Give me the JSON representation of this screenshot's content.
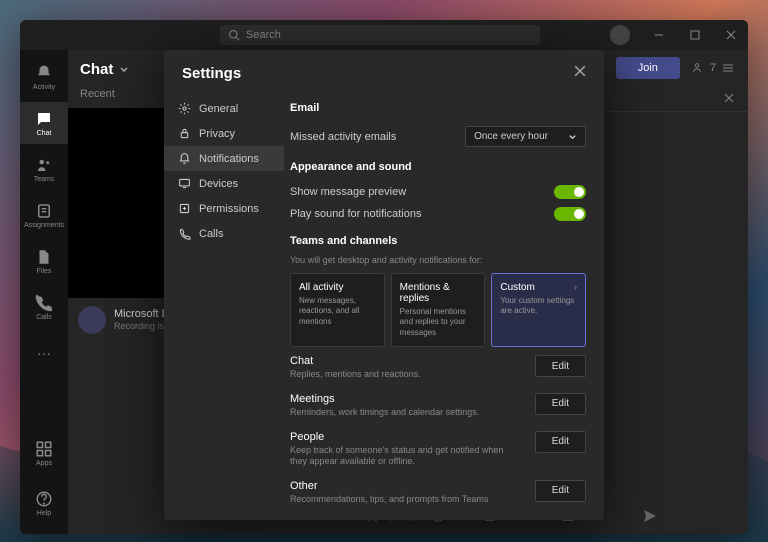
{
  "titlebar": {
    "search_placeholder": "Search"
  },
  "rail": {
    "items": [
      {
        "label": "Activity"
      },
      {
        "label": "Chat"
      },
      {
        "label": "Teams"
      },
      {
        "label": "Assignments"
      },
      {
        "label": "Files"
      },
      {
        "label": "Calls"
      }
    ],
    "more": "···",
    "apps": "Apps",
    "help": "Help"
  },
  "chatcol": {
    "title": "Chat",
    "tab": "Recent",
    "item": {
      "title": "Microsoft Digital Brief",
      "sub": "Recording is ready"
    }
  },
  "meetbar": {
    "join": "Join"
  },
  "settings": {
    "title": "Settings",
    "nav": [
      {
        "label": "General"
      },
      {
        "label": "Privacy"
      },
      {
        "label": "Notifications"
      },
      {
        "label": "Devices"
      },
      {
        "label": "Permissions"
      },
      {
        "label": "Calls"
      }
    ],
    "email": {
      "head": "Email",
      "row_label": "Missed activity emails",
      "select": "Once every hour"
    },
    "appearance": {
      "head": "Appearance and sound",
      "preview": "Show message preview",
      "sound": "Play sound for notifications"
    },
    "teams": {
      "head": "Teams and channels",
      "sub": "You will get desktop and activity notifications for:",
      "cards": [
        {
          "title": "All activity",
          "sub": "New messages, reactions, and all mentions"
        },
        {
          "title": "Mentions & replies",
          "sub": "Personal mentions and replies to your messages"
        },
        {
          "title": "Custom",
          "sub": "Your custom settings are active."
        }
      ]
    },
    "sections": [
      {
        "title": "Chat",
        "sub": "Replies, mentions and reactions.",
        "btn": "Edit"
      },
      {
        "title": "Meetings",
        "sub": "Reminders, work timings and calendar settings.",
        "btn": "Edit"
      },
      {
        "title": "People",
        "sub": "Keep track of someone's status and get notified when they appear available or offline.",
        "btn": "Edit"
      },
      {
        "title": "Other",
        "sub": "Recommendations, tips, and prompts from Teams",
        "btn": "Edit"
      }
    ]
  }
}
